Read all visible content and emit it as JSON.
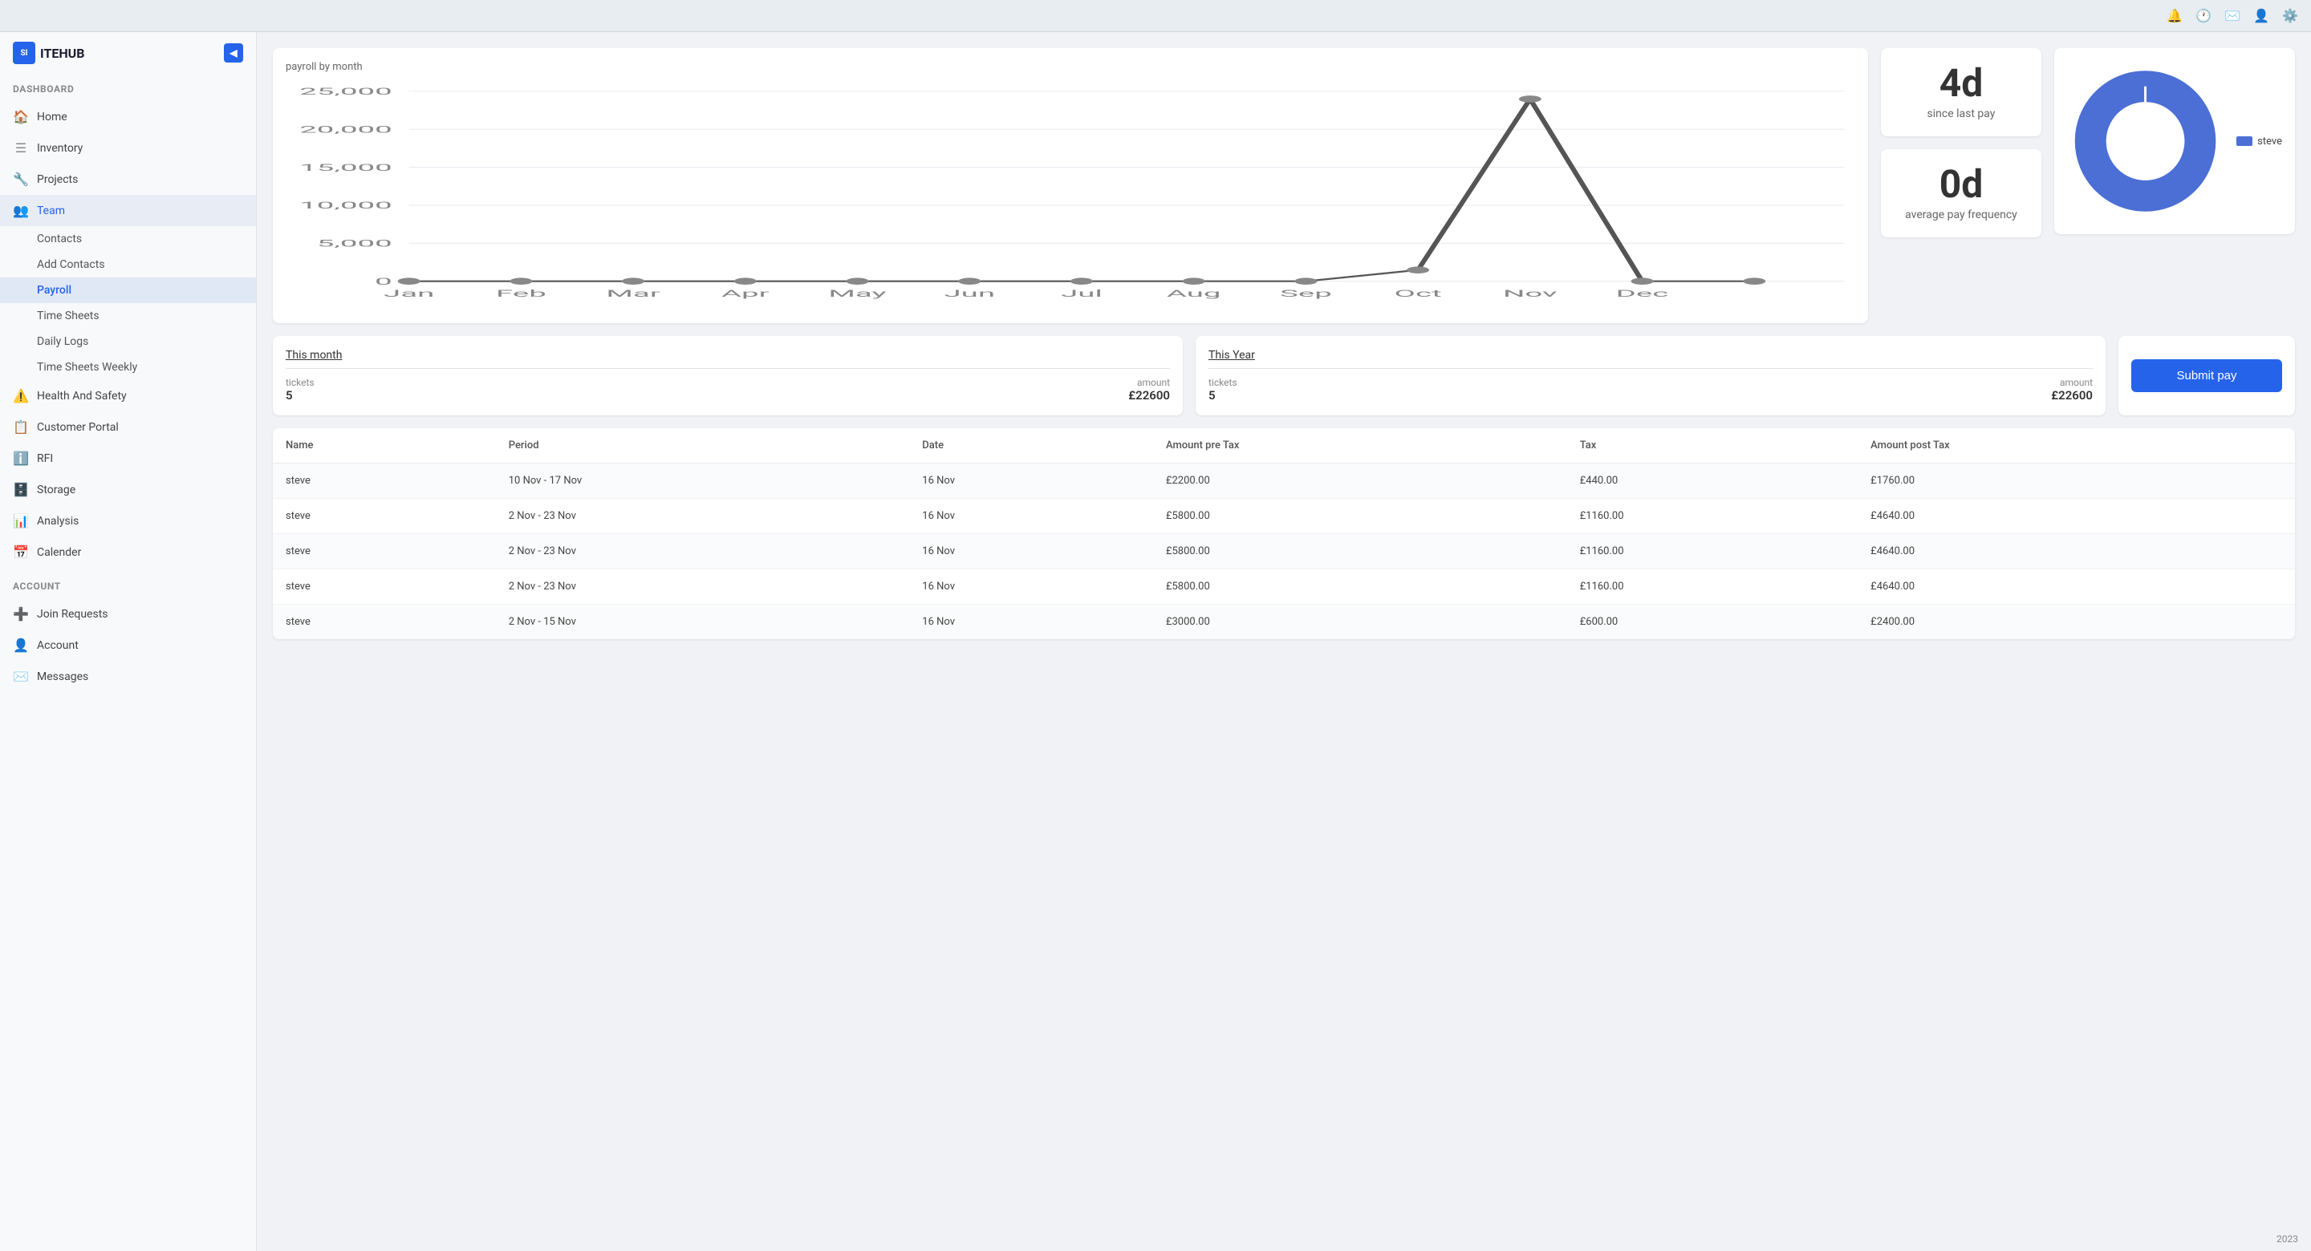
{
  "header": {
    "logo_text": "ITEHUB",
    "logo_short": "SI",
    "icons": [
      "bell-icon",
      "clock-icon",
      "mail-icon",
      "user-icon",
      "gear-icon"
    ]
  },
  "sidebar": {
    "section_dashboard": "DASHBOARD",
    "section_account": "ACCOUNT",
    "nav_items": [
      {
        "id": "home",
        "label": "Home",
        "icon": "🏠"
      },
      {
        "id": "inventory",
        "label": "Inventory",
        "icon": "☰"
      },
      {
        "id": "projects",
        "label": "Projects",
        "icon": "🔧"
      },
      {
        "id": "team",
        "label": "Team",
        "icon": "👥",
        "active": true
      },
      {
        "id": "health-safety",
        "label": "Health And Safety",
        "icon": "⚠️"
      },
      {
        "id": "customer-portal",
        "label": "Customer Portal",
        "icon": "📋"
      },
      {
        "id": "rfi",
        "label": "RFI",
        "icon": "ℹ️"
      },
      {
        "id": "storage",
        "label": "Storage",
        "icon": "🗄️"
      },
      {
        "id": "analysis",
        "label": "Analysis",
        "icon": "📊"
      },
      {
        "id": "calender",
        "label": "Calender",
        "icon": "📅"
      }
    ],
    "team_sub_items": [
      {
        "id": "contacts",
        "label": "Contacts"
      },
      {
        "id": "add-contacts",
        "label": "Add Contacts"
      },
      {
        "id": "payroll",
        "label": "Payroll",
        "active": true
      },
      {
        "id": "time-sheets",
        "label": "Time Sheets"
      },
      {
        "id": "daily-logs",
        "label": "Daily Logs"
      },
      {
        "id": "time-sheets-weekly",
        "label": "Time Sheets Weekly"
      }
    ],
    "account_items": [
      {
        "id": "join-requests",
        "label": "Join Requests",
        "icon": "➕"
      },
      {
        "id": "account",
        "label": "Account",
        "icon": "👤"
      },
      {
        "id": "messages",
        "label": "Messages",
        "icon": "✉️"
      }
    ]
  },
  "chart": {
    "title": "payroll by month",
    "y_labels": [
      "25,000",
      "20,000",
      "15,000",
      "10,000",
      "5,000",
      "0"
    ],
    "x_labels": [
      "Jan",
      "Feb",
      "Mar",
      "Apr",
      "May",
      "Jun",
      "Jul",
      "Aug",
      "Sep",
      "Oct",
      "Nov",
      "Dec"
    ],
    "data_points": [
      0,
      0,
      0,
      0,
      0,
      0,
      0,
      0,
      0,
      1500,
      24000,
      0
    ],
    "max_value": 25000
  },
  "stats": {
    "since_last_pay_value": "4d",
    "since_last_pay_label": "since last pay",
    "avg_pay_freq_value": "0d",
    "avg_pay_freq_label": "average pay frequency"
  },
  "donut": {
    "legend_label": "steve",
    "segments": [
      {
        "label": "steve",
        "value": 100,
        "color": "#4b6fd4"
      }
    ]
  },
  "this_month": {
    "title": "This month",
    "tickets_label": "tickets",
    "tickets_value": "5",
    "amount_label": "amount",
    "amount_value": "£22600"
  },
  "this_year": {
    "title": "This Year",
    "tickets_label": "tickets",
    "tickets_value": "5",
    "amount_label": "amount",
    "amount_value": "£22600"
  },
  "submit": {
    "label": "Submit pay"
  },
  "table": {
    "headers": [
      "Name",
      "Period",
      "Date",
      "Amount pre Tax",
      "Tax",
      "Amount post Tax"
    ],
    "rows": [
      {
        "name": "steve",
        "period": "10 Nov - 17 Nov",
        "date": "16 Nov",
        "amount_pre": "£2200.00",
        "tax": "£440.00",
        "amount_post": "£1760.00"
      },
      {
        "name": "steve",
        "period": "2 Nov - 23 Nov",
        "date": "16 Nov",
        "amount_pre": "£5800.00",
        "tax": "£1160.00",
        "amount_post": "£4640.00"
      },
      {
        "name": "steve",
        "period": "2 Nov - 23 Nov",
        "date": "16 Nov",
        "amount_pre": "£5800.00",
        "tax": "£1160.00",
        "amount_post": "£4640.00"
      },
      {
        "name": "steve",
        "period": "2 Nov - 23 Nov",
        "date": "16 Nov",
        "amount_pre": "£5800.00",
        "tax": "£1160.00",
        "amount_post": "£4640.00"
      },
      {
        "name": "steve",
        "period": "2 Nov - 15 Nov",
        "date": "16 Nov",
        "amount_pre": "£3000.00",
        "tax": "£600.00",
        "amount_post": "£2400.00"
      }
    ]
  },
  "year_badge": "2023"
}
